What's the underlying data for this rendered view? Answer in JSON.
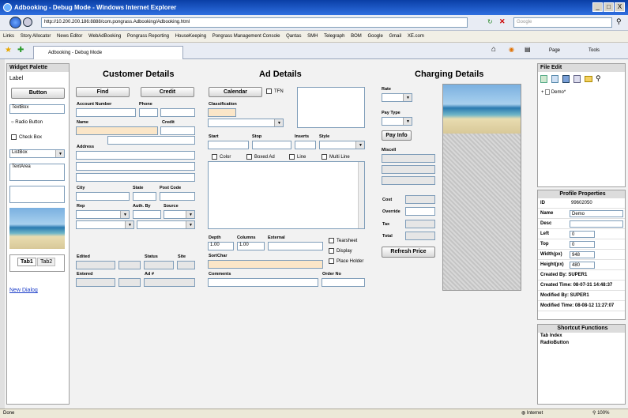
{
  "window": {
    "title": "Adbooking - Debug Mode - Windows Internet Explorer",
    "min": "_",
    "max": "□",
    "close": "X"
  },
  "address": {
    "url": "http://10.200.200.186:8888/com.pongrass.Adbooking/Adbooking.html",
    "search_placeholder": "Google"
  },
  "links": [
    "Links",
    "Story Allocator",
    "News Editor",
    "WebAdBooking",
    "Pongrass Reporting",
    "HouseKeeping",
    "Pongrass Management Console",
    "Qantas",
    "SMH",
    "Telegraph",
    "BOM",
    "Google",
    "Gmail",
    "XE.com"
  ],
  "tab": {
    "label": "Adbooking - Debug Mode"
  },
  "cmdbar": {
    "page": "Page",
    "tools": "Tools"
  },
  "palette": {
    "title": "Widget Palette",
    "label": "Label",
    "button": "Button",
    "textbox": "TextBox",
    "radio": "Radio Button",
    "check": "Check Box",
    "listbox": "ListBox",
    "textarea": "TextArea",
    "tab1": "Tab1",
    "tab2": "Tab2",
    "new_dialog": "New Dialog"
  },
  "customer": {
    "title": "Customer Details",
    "find": "Find",
    "credit_btn": "Credit",
    "account": "Account Number",
    "phone": "Phone",
    "name": "Name",
    "credit": "Credit",
    "address": "Address",
    "city": "City",
    "state": "State",
    "postcode": "Post Code",
    "rep": "Rep",
    "auth": "Auth. By",
    "source": "Source",
    "edited": "Edited",
    "status": "Status",
    "site": "Site",
    "entered": "Entered",
    "adno": "Ad #"
  },
  "ad": {
    "title": "Ad Details",
    "calendar": "Calendar",
    "tfn": "TFN",
    "classification": "Classification",
    "start": "Start",
    "stop": "Stop",
    "inserts": "Inserts",
    "style": "Style",
    "color": "Color",
    "boxed": "Boxed Ad",
    "line": "Line",
    "multiline": "Multi Line",
    "depth": "Depth",
    "columns": "Columns",
    "external": "External",
    "depth_val": "1.00",
    "columns_val": "1.00",
    "tearsheet": "Tearsheet",
    "display": "Display",
    "placeholder": "Place Holder",
    "sortchar": "SortChar",
    "comments": "Comments",
    "orderno": "Order No"
  },
  "charging": {
    "title": "Charging Details",
    "rate": "Rate",
    "paytype": "Pay Type",
    "payinfo": "Pay Info",
    "miscell": "Miscell",
    "cost": "Cost",
    "override": "Override",
    "tax": "Tax",
    "total": "Total",
    "refresh": "Refresh Price"
  },
  "filetree": {
    "menu_file": "File",
    "menu_edit": "Edit",
    "node": "Demo*"
  },
  "profile": {
    "title": "Profile Properties",
    "id_label": "ID",
    "id_val": "99602050",
    "name_label": "Name",
    "name_val": "Demo",
    "desc_label": "Desc",
    "left_label": "Left",
    "left_val": "0",
    "top_label": "Top",
    "top_val": "0",
    "width_label": "Width(px)",
    "width_val": "948",
    "height_label": "Height(px)",
    "height_val": "480",
    "created_by": "Created By: SUPER1",
    "created_time": "Created Time: 08-07-31 14:48:37",
    "modified_by": "Modified By: SUPER1",
    "modified_time": "Modified Time: 08-08-12 11:27:07"
  },
  "shortcuts": {
    "title": "Shortcut Functions",
    "items": [
      "Tab Index",
      "RadioButton"
    ]
  },
  "status": {
    "left": "Done",
    "zone": "Internet",
    "zoom": "100%"
  }
}
